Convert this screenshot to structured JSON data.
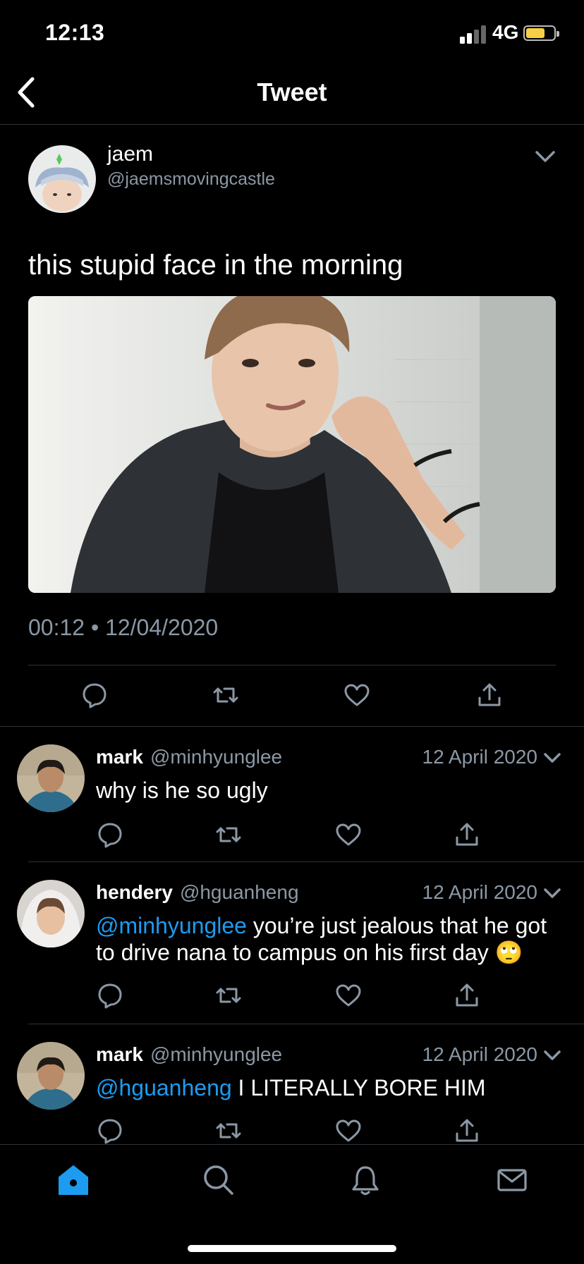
{
  "status_bar": {
    "time": "12:13",
    "network": "4G",
    "battery_color": "#f7ce46"
  },
  "nav": {
    "title": "Tweet"
  },
  "tweet": {
    "author_name": "jaem",
    "author_handle": "@jaemsmovingcastle",
    "text": "this stupid face in the morning",
    "timestamp": "00:12 • 12/04/2020"
  },
  "replies": [
    {
      "name": "mark",
      "handle": "@minhyunglee",
      "date": "12 April 2020",
      "mention": "",
      "text": "why is he so ugly"
    },
    {
      "name": "hendery",
      "handle": "@hguanheng",
      "date": "12 April 2020",
      "mention": "@minhyunglee",
      "text": " you’re just jealous that he got to drive nana to campus on his first day 🙄"
    },
    {
      "name": "mark",
      "handle": "@minhyunglee",
      "date": "12 April 2020",
      "mention": "@hguanheng",
      "text": " I LITERALLY BORE HIM"
    }
  ],
  "icons": [
    "back-icon",
    "chevron-down-icon",
    "reply-icon",
    "retweet-icon",
    "like-icon",
    "share-icon",
    "home-icon",
    "search-icon",
    "notifications-icon",
    "messages-icon"
  ],
  "colors": {
    "accent": "#1d9bf0",
    "secondary_text": "#8b98a5",
    "background": "#000000"
  }
}
